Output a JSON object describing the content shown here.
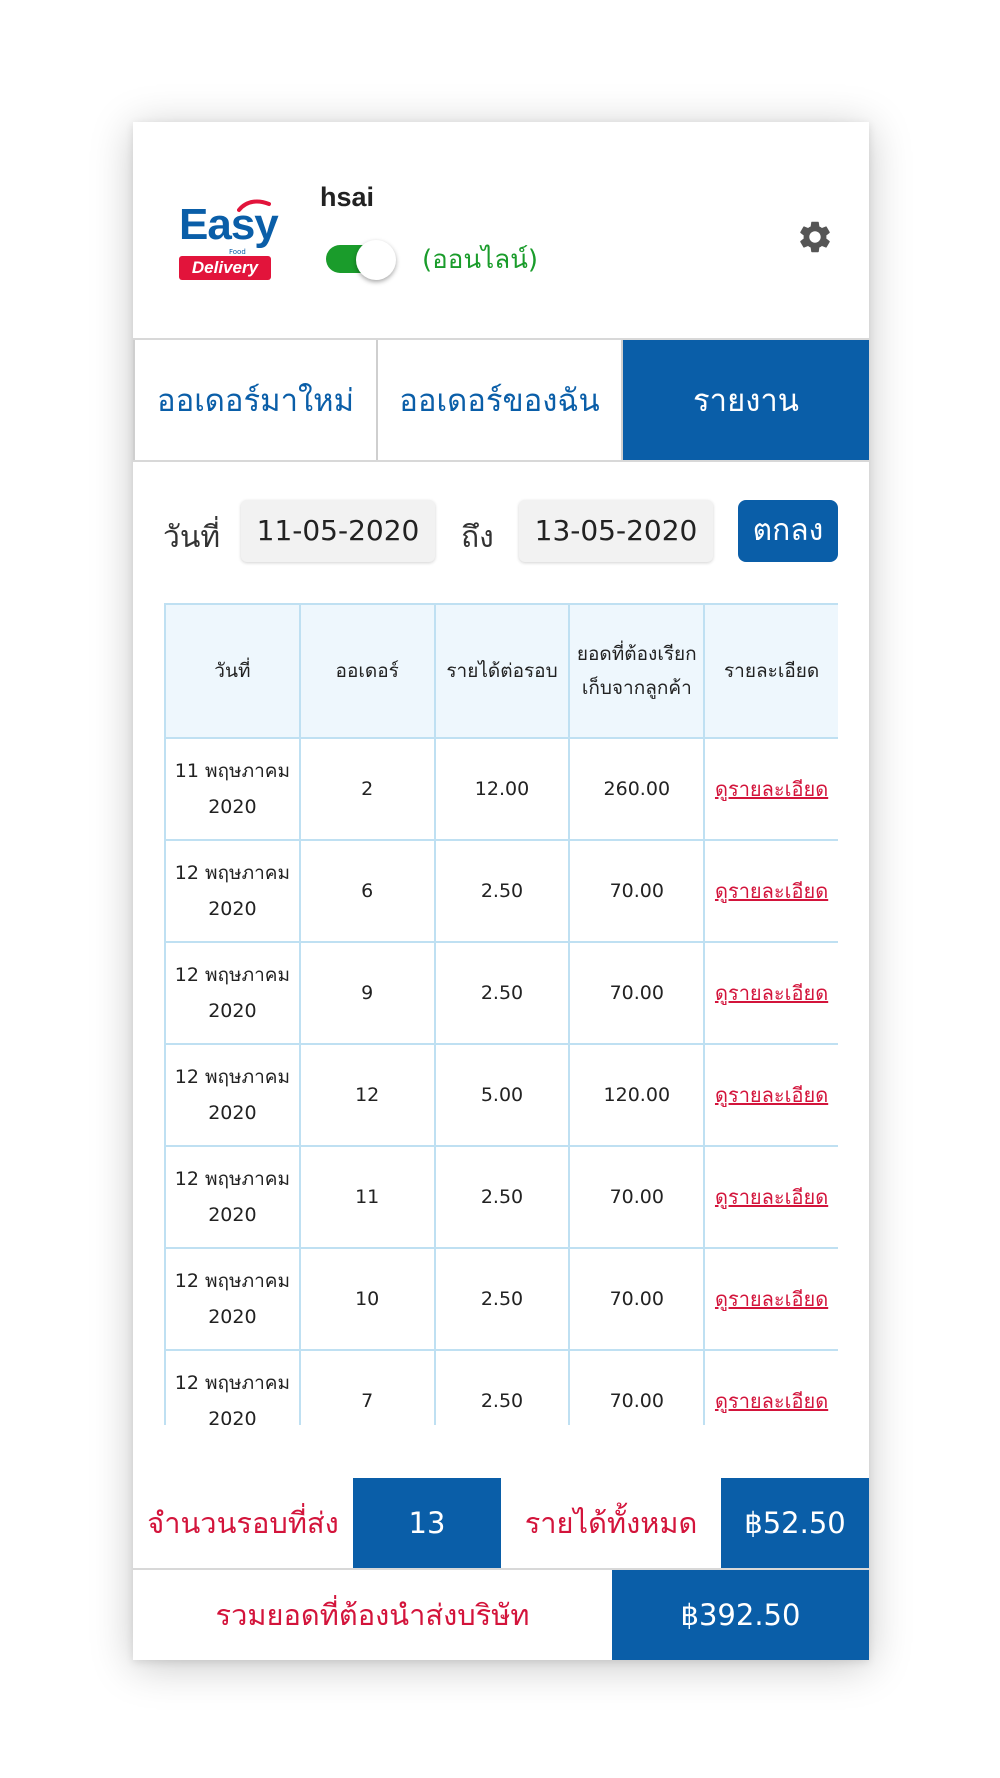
{
  "header": {
    "logo_text": "Easy",
    "logo_sub": "Food",
    "logo_badge": "Delivery",
    "username": "hsai",
    "online_on": true,
    "status_text": "(ออนไลน์)",
    "settings_icon": "gear-icon"
  },
  "tabs": [
    {
      "label": "ออเดอร์มาใหม่",
      "active": false
    },
    {
      "label": "ออเดอร์ของฉัน",
      "active": false
    },
    {
      "label": "รายงาน",
      "active": true
    }
  ],
  "filter": {
    "from_label": "วันที่",
    "from_value": "11-05-2020",
    "to_label": "ถึง",
    "to_value": "13-05-2020",
    "submit_label": "ตกลง"
  },
  "table": {
    "headers": [
      "วันที่",
      "ออเดอร์",
      "รายได้ต่อรอบ",
      "ยอดที่ต้องเรียกเก็บจากลูกค้า",
      "รายละเอียด"
    ],
    "link_label": "ดูรายละเอียด",
    "rows": [
      {
        "date": "11 พฤษภาคม 2020",
        "order": "2",
        "income": "12.00",
        "collect": "260.00"
      },
      {
        "date": "12 พฤษภาคม 2020",
        "order": "6",
        "income": "2.50",
        "collect": "70.00"
      },
      {
        "date": "12 พฤษภาคม 2020",
        "order": "9",
        "income": "2.50",
        "collect": "70.00"
      },
      {
        "date": "12 พฤษภาคม 2020",
        "order": "12",
        "income": "5.00",
        "collect": "120.00"
      },
      {
        "date": "12 พฤษภาคม 2020",
        "order": "11",
        "income": "2.50",
        "collect": "70.00"
      },
      {
        "date": "12 พฤษภาคม 2020",
        "order": "10",
        "income": "2.50",
        "collect": "70.00"
      },
      {
        "date": "12 พฤษภาคม 2020",
        "order": "7",
        "income": "2.50",
        "collect": "70.00"
      }
    ]
  },
  "summary": {
    "rounds_label": "จำนวนรอบที่ส่ง",
    "rounds_value": "13",
    "income_label": "รายได้ทั้งหมด",
    "income_value": "฿52.50",
    "total_label": "รวมยอดที่ต้องนำส่งบริษัท",
    "total_value": "฿392.50"
  },
  "colors": {
    "primary": "#0a5ea8",
    "accent_red": "#d3143b",
    "online_green": "#1a9c2b",
    "table_border": "#bfe0f2",
    "header_bg": "#eef7fd"
  }
}
